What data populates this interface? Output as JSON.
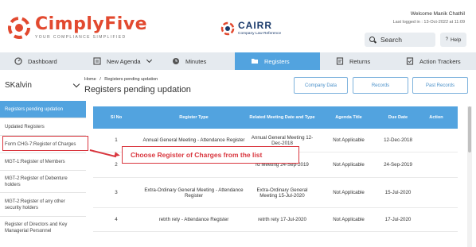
{
  "brand": {
    "name_part1": "Cimply",
    "name_part2": "Five",
    "tagline": "YOUR COMPLIANCE SIMPLIFIED",
    "partner_name": "CAIRR",
    "partner_sub": "Company Law Reference"
  },
  "user": {
    "welcome": "Welcome Manik  Chathil",
    "last_login": "Last logged in : 13-Oct-2022 at 11:09"
  },
  "search": {
    "label": "Search"
  },
  "help": {
    "label": "Help",
    "icon": "?"
  },
  "nav": {
    "items": [
      {
        "label": "Dashboard",
        "icon": "dashboard-icon"
      },
      {
        "label": "New Agenda",
        "icon": "agenda-icon"
      },
      {
        "label": "Minutes",
        "icon": "minutes-icon"
      },
      {
        "label": "Registers",
        "icon": "registers-icon",
        "active": true
      },
      {
        "label": "Returns",
        "icon": "returns-icon"
      },
      {
        "label": "Action Trackers",
        "icon": "action-tracker-icon"
      }
    ]
  },
  "company": {
    "selected": "SKalvin"
  },
  "breadcrumb": {
    "home": "Home",
    "sep": "/",
    "current": "Registers pending updation"
  },
  "page": {
    "title": "Registers pending updation"
  },
  "buttons": {
    "company_data": "Company Data",
    "records": "Records",
    "past_records": "Past Records"
  },
  "sidebar": {
    "items": [
      {
        "label": "Registers pending updation",
        "active": true
      },
      {
        "label": "Updated Registers"
      },
      {
        "label": "Form CHG-7:Register of Charges"
      },
      {
        "label": "MGT-1:Register of Members"
      },
      {
        "label": "MGT-2:Register of Debenture holders"
      },
      {
        "label": "MGT-2:Register of any other security holders"
      },
      {
        "label": "Register of Directors and Key Managerial Personnel"
      }
    ]
  },
  "table": {
    "headers": [
      "Sl No",
      "Register Type",
      "Related Meeting Date and Type",
      "Agenda Title",
      "Due Date",
      "Action"
    ],
    "rows": [
      {
        "sl": "1",
        "type": "Annual General Meeting - Attendance Register",
        "meeting": "Annual General Meeting 12-Dec-2018",
        "agenda": "Not Applicable",
        "due": "12-Dec-2018"
      },
      {
        "sl": "2",
        "type": "",
        "meeting": "rd Meeting 24-Sep-2019",
        "agenda": "Not Applicable",
        "due": "24-Sep-2019"
      },
      {
        "sl": "3",
        "type": "Extra-Ordinary General Meeting - Attendance Register",
        "meeting": "Extra-Ordinary General Meeting 15-Jul-2020",
        "agenda": "Not Applicable",
        "due": "15-Jul-2020"
      },
      {
        "sl": "4",
        "type": "retrth rety - Attendance Register",
        "meeting": "retrth rety 17-Jul-2020",
        "agenda": "Not Applicable",
        "due": "17-Jul-2020"
      }
    ]
  },
  "annotation": {
    "text": "Choose Register of Charges from the list"
  },
  "colors": {
    "brand_red": "#e2492f",
    "accent_blue": "#52a3df",
    "nav_bg": "#e5eaef",
    "callout_red": "#d9363e"
  }
}
